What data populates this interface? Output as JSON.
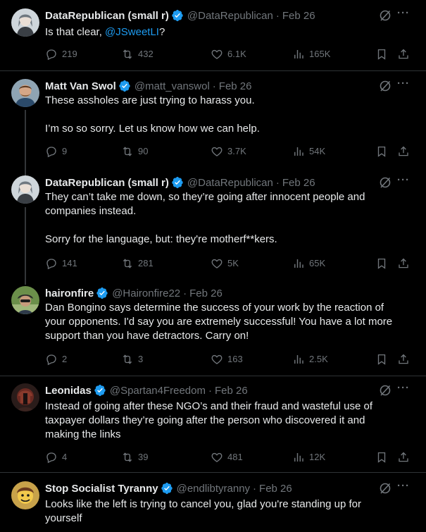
{
  "colors": {
    "background": "#000000",
    "text": "#e7e9ea",
    "muted": "#71767b",
    "link": "#1d9bf0",
    "verified": "#1d9bf0",
    "divider": "#2f3336"
  },
  "tweets": [
    {
      "name": "DataRepublican (small r)",
      "handle": "@DataRepublican",
      "dot": "·",
      "date": "Feb 26",
      "verified_icon": "verified-badge-icon",
      "text_before": "Is that clear, ",
      "mention": "@JSweetLI",
      "text_after": "?",
      "replies": "219",
      "reposts": "432",
      "likes": "6.1K",
      "views": "165K"
    },
    {
      "name": "Matt Van Swol",
      "handle": "@matt_vanswol",
      "dot": "·",
      "date": "Feb 26",
      "verified_icon": "verified-badge-icon",
      "lines": [
        "These assholes are just trying to harass you.",
        "I’m so so sorry. Let us know how we can help."
      ],
      "replies": "9",
      "reposts": "90",
      "likes": "3.7K",
      "views": "54K"
    },
    {
      "name": "DataRepublican (small r)",
      "handle": "@DataRepublican",
      "dot": "·",
      "date": "Feb 26",
      "verified_icon": "verified-badge-icon",
      "lines": [
        "They can’t take me down, so they’re going after innocent people and",
        "companies instead.",
        "Sorry for the language, but: they're motherf**kers."
      ],
      "replies": "141",
      "reposts": "281",
      "likes": "5K",
      "views": "65K"
    },
    {
      "name": "haironfire",
      "handle": "@Haironfire22",
      "dot": "·",
      "date": "Feb 26",
      "verified_icon": "verified-badge-icon",
      "lines": [
        "Dan Bongino says determine the success of your work by the reaction of",
        "your opponents. I'd say you are extremely successful! You have a lot more",
        "support than you have detractors. Carry on!"
      ],
      "replies": "2",
      "reposts": "3",
      "likes": "163",
      "views": "2.5K"
    },
    {
      "name": "Leonidas",
      "handle": "@Spartan4Freedom",
      "dot": "·",
      "date": "Feb 26",
      "verified_icon": "verified-badge-icon",
      "lines": [
        "Instead of going after these NGO’s and their fraud and wasteful use of",
        "taxpayer dollars they’re going after the person who discovered it and",
        "making the links"
      ],
      "replies": "4",
      "reposts": "39",
      "likes": "481",
      "views": "12K"
    },
    {
      "name": "Stop Socialist Tyranny",
      "handle": "@endlibtyranny",
      "dot": "·",
      "date": "Feb 26",
      "verified_icon": "verified-badge-icon",
      "lines": [
        "Looks like the left is trying to cancel you, glad you're standing up for",
        "yourself"
      ]
    }
  ],
  "icons": {
    "reply": "reply-icon",
    "repost": "repost-icon",
    "like": "heart-icon",
    "views": "views-icon",
    "bookmark": "bookmark-icon",
    "share": "share-icon",
    "grok": "grok-icon",
    "more": "more-icon"
  }
}
